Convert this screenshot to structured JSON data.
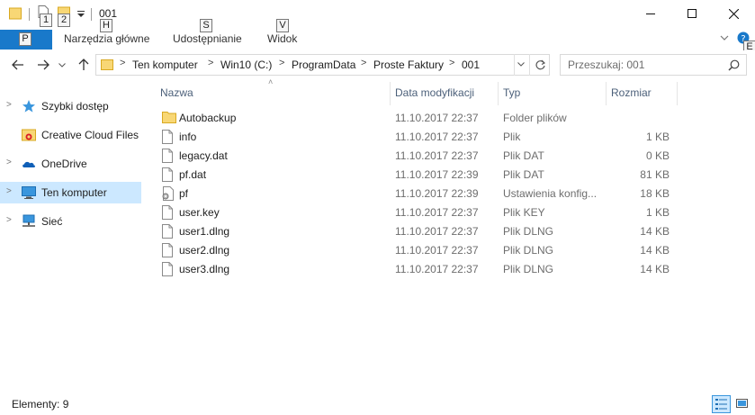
{
  "window": {
    "title": "001",
    "minimize_icon": "minimize-icon",
    "maximize_icon": "maximize-icon",
    "close_icon": "close-icon"
  },
  "keytips": {
    "k1": "1",
    "k2": "2",
    "file": "P",
    "home": "H",
    "share": "S",
    "view": "V",
    "help": "E"
  },
  "ribbon": {
    "tabs": [
      {
        "label": "Narzędzia główne"
      },
      {
        "label": "Udostępnianie"
      },
      {
        "label": "Widok"
      }
    ]
  },
  "address": {
    "crumbs": [
      "Ten komputer",
      "Win10 (C:)",
      "ProgramData",
      "Proste Faktury",
      "001"
    ]
  },
  "search": {
    "placeholder": "Przeszukaj: 001"
  },
  "nav_pane": {
    "items": [
      {
        "label": "Szybki dostęp",
        "icon": "star-icon",
        "expandable": true
      },
      {
        "label": "Creative Cloud Files",
        "icon": "creative-cloud-folder-icon",
        "expandable": false
      },
      {
        "label": "OneDrive",
        "icon": "onedrive-cloud-icon",
        "expandable": true
      },
      {
        "label": "Ten komputer",
        "icon": "computer-icon",
        "expandable": true,
        "selected": true
      },
      {
        "label": "Sieć",
        "icon": "network-icon",
        "expandable": true
      }
    ]
  },
  "columns": {
    "name": "Nazwa",
    "date": "Data modyfikacji",
    "type": "Typ",
    "size": "Rozmiar"
  },
  "files": [
    {
      "name": "Autobackup",
      "date": "11.10.2017 22:37",
      "type": "Folder plików",
      "size": "",
      "icon": "folder-icon"
    },
    {
      "name": "info",
      "date": "11.10.2017 22:37",
      "type": "Plik",
      "size": "1 KB",
      "icon": "file-icon"
    },
    {
      "name": "legacy.dat",
      "date": "11.10.2017 22:37",
      "type": "Plik DAT",
      "size": "0 KB",
      "icon": "file-icon"
    },
    {
      "name": "pf.dat",
      "date": "11.10.2017 22:39",
      "type": "Plik DAT",
      "size": "81 KB",
      "icon": "file-icon"
    },
    {
      "name": "pf",
      "date": "11.10.2017 22:39",
      "type": "Ustawienia konfig...",
      "size": "18 KB",
      "icon": "settings-file-icon"
    },
    {
      "name": "user.key",
      "date": "11.10.2017 22:37",
      "type": "Plik KEY",
      "size": "1 KB",
      "icon": "file-icon"
    },
    {
      "name": "user1.dlng",
      "date": "11.10.2017 22:37",
      "type": "Plik DLNG",
      "size": "14 KB",
      "icon": "file-icon"
    },
    {
      "name": "user2.dlng",
      "date": "11.10.2017 22:37",
      "type": "Plik DLNG",
      "size": "14 KB",
      "icon": "file-icon"
    },
    {
      "name": "user3.dlng",
      "date": "11.10.2017 22:37",
      "type": "Plik DLNG",
      "size": "14 KB",
      "icon": "file-icon"
    }
  ],
  "status": {
    "items_text": "Elementy: 9"
  },
  "colors": {
    "accent": "#1979ca",
    "selection": "#cce8ff",
    "header_text": "#4c607a",
    "folder": "#f8d775"
  }
}
